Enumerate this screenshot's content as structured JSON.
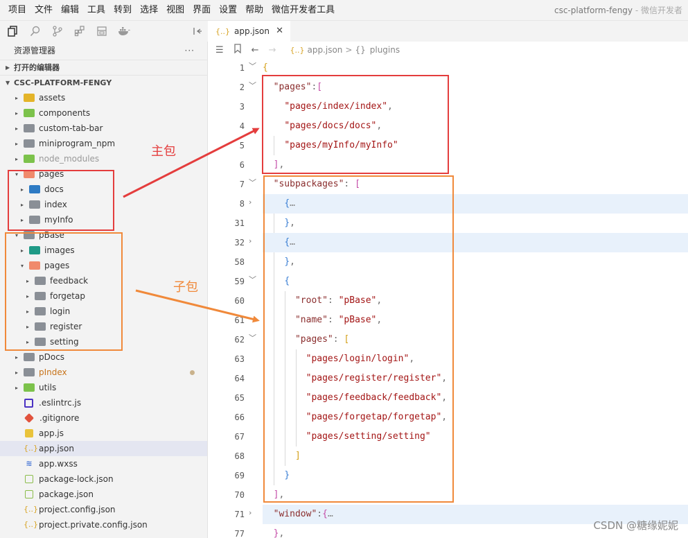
{
  "menu": [
    "项目",
    "文件",
    "编辑",
    "工具",
    "转到",
    "选择",
    "视图",
    "界面",
    "设置",
    "帮助",
    "微信开发者工具"
  ],
  "window_title": {
    "project": "csc-platform-fengy",
    "sep": " - ",
    "app": "微信开发者"
  },
  "sidebar": {
    "title": "资源管理器",
    "more": "···",
    "open_editors": "打开的编辑器",
    "project_root": "CSC-PLATFORM-FENGY",
    "tree": [
      {
        "name": "assets",
        "icon": "folder-yellow",
        "caret": "▸",
        "indent": 0
      },
      {
        "name": "components",
        "icon": "folder-green",
        "caret": "▸",
        "indent": 0
      },
      {
        "name": "custom-tab-bar",
        "icon": "folder",
        "caret": "▸",
        "indent": 0
      },
      {
        "name": "miniprogram_npm",
        "icon": "folder",
        "caret": "▸",
        "indent": 0
      },
      {
        "name": "node_modules",
        "icon": "folder-green",
        "caret": "▸",
        "indent": 0,
        "dim": true
      },
      {
        "name": "pages",
        "icon": "folder-open",
        "caret": "▾",
        "indent": 0
      },
      {
        "name": "docs",
        "icon": "folder-blue",
        "caret": "▸",
        "indent": 1
      },
      {
        "name": "index",
        "icon": "folder",
        "caret": "▸",
        "indent": 1
      },
      {
        "name": "myInfo",
        "icon": "folder",
        "caret": "▸",
        "indent": 1
      },
      {
        "name": "pBase",
        "icon": "folder",
        "caret": "▾",
        "indent": 0
      },
      {
        "name": "images",
        "icon": "folder-teal",
        "caret": "▸",
        "indent": 1
      },
      {
        "name": "pages",
        "icon": "folder-open",
        "caret": "▾",
        "indent": 1
      },
      {
        "name": "feedback",
        "icon": "folder",
        "caret": "▸",
        "indent": 2
      },
      {
        "name": "forgetap",
        "icon": "folder",
        "caret": "▸",
        "indent": 2
      },
      {
        "name": "login",
        "icon": "folder",
        "caret": "▸",
        "indent": 2
      },
      {
        "name": "register",
        "icon": "folder",
        "caret": "▸",
        "indent": 2
      },
      {
        "name": "setting",
        "icon": "folder",
        "caret": "▸",
        "indent": 2
      },
      {
        "name": "pDocs",
        "icon": "folder",
        "caret": "▸",
        "indent": 0
      },
      {
        "name": "pIndex",
        "icon": "folder",
        "caret": "▸",
        "indent": 0,
        "orange": true,
        "dot": true
      },
      {
        "name": "utils",
        "icon": "folder-green",
        "caret": "▸",
        "indent": 0
      },
      {
        "name": ".eslintrc.js",
        "icon": "fi-eslint",
        "caret": "",
        "indent": 0
      },
      {
        "name": ".gitignore",
        "icon": "fi-git",
        "caret": "",
        "indent": 0
      },
      {
        "name": "app.js",
        "icon": "fi-js",
        "caret": "",
        "indent": 0
      },
      {
        "name": "app.json",
        "icon": "fi-json",
        "caret": "",
        "indent": 0,
        "selected": true
      },
      {
        "name": "app.wxss",
        "icon": "fi-css",
        "caret": "",
        "indent": 0
      },
      {
        "name": "package-lock.json",
        "icon": "fi-pkg",
        "caret": "",
        "indent": 0
      },
      {
        "name": "package.json",
        "icon": "fi-pkg",
        "caret": "",
        "indent": 0
      },
      {
        "name": "project.config.json",
        "icon": "fi-json",
        "caret": "",
        "indent": 0
      },
      {
        "name": "project.private.config.json",
        "icon": "fi-json",
        "caret": "",
        "indent": 0
      }
    ]
  },
  "tab": {
    "icon": "{..}",
    "label": "app.json",
    "close": "✕"
  },
  "breadcrumb": {
    "file_icon": "{..}",
    "file": "app.json",
    "sep": ">",
    "node_icon": "{}",
    "node": "plugins"
  },
  "annotations": {
    "main_package": "主包",
    "sub_package": "子包"
  },
  "watermark": "CSDN @糖缘妮妮",
  "colors": {
    "red_box": "#e43d3d",
    "orange_box": "#f0893a",
    "selected_row": "#e4e6f1",
    "highlight_line": "#e8f1fb"
  }
}
